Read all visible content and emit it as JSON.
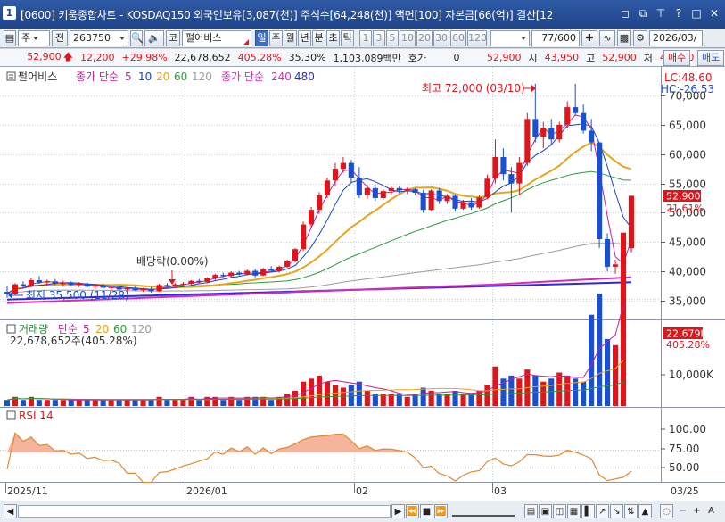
{
  "window": {
    "app_icon": "1",
    "title": "[0600] 키움종합차트 - KOSDAQ150 외국인보유[3,087(천)] 주식수[64,248(천)] 액면[100] 자본금[66(억)] 결산[12",
    "controls": [
      "minimize-icon",
      "restore-icon",
      "pin-icon",
      "help-icon",
      "maximize-icon",
      "close-icon"
    ]
  },
  "toolbar": {
    "period_type": "주",
    "market_btn": "전",
    "stock_code": "263750",
    "sound_icon": "speaker-icon",
    "market_tag": "코",
    "stock_name": "펄어비스",
    "periods": [
      "일",
      "주",
      "월",
      "년",
      "분",
      "초",
      "틱"
    ],
    "selected_period": "일",
    "intervals": [
      "1",
      "3",
      "5",
      "10",
      "20",
      "30",
      "60",
      "120"
    ],
    "page_counter": "77/600",
    "date": "2026/03/"
  },
  "pricebar": {
    "price": "52,900",
    "change": "12,200",
    "change_pct": "+29.98%",
    "volume": "22,678,652",
    "vol_ratio": "405.28%",
    "turnover": "35.30%",
    "amount": "1,103,089백만",
    "hoga_label": "호가",
    "hoga_value": "0",
    "ask_price": "52,900",
    "open_label": "시",
    "open": "43,950",
    "high_label": "고",
    "high": "52,900",
    "low_label": "저",
    "low": "43,250",
    "buy_btn": "매수",
    "sell_btn": "매도"
  },
  "legend": {
    "stock_tag": "펄어비스",
    "ma_label": "종가 단순",
    "ma_periods": [
      "5",
      "10",
      "20",
      "60",
      "120"
    ],
    "ma2_label": "종가 단순",
    "ma2_periods": [
      "240",
      "480"
    ]
  },
  "annotations": {
    "high_note": "최고 72,000 (03/10)",
    "low_note": "최저 35,500 (11/28)",
    "dividend_note": "배당락(0.00%)"
  },
  "price_axis": {
    "ticks": [
      "70,000",
      "65,000",
      "60,000",
      "55,000",
      "50,000",
      "45,000",
      "40,000",
      "35,000"
    ],
    "lc": "LC:48.60",
    "hc": "HC:-26.53",
    "current_price_tag": "52,900",
    "current_change_tag": "21.61%"
  },
  "volume_panel": {
    "title": "거래량",
    "ma_label": "단순",
    "ma_periods": [
      "5",
      "20",
      "60",
      "120"
    ],
    "value_text": "22,678,652주(405.28%)",
    "axis_tick": "10,000K",
    "current_tag": "22,679K",
    "current_pct": "405.28%"
  },
  "rsi_panel": {
    "title": "RSI 14",
    "ticks": [
      "100.00",
      "75.00",
      "50.00"
    ]
  },
  "date_axis": [
    "2025/11",
    "2026/01",
    "02",
    "03",
    "03/25"
  ],
  "colors": {
    "up": "#e1141a",
    "down": "#1b4fd1",
    "ma5": "#c21f9b",
    "ma10": "#1546c8",
    "ma20": "#e7a51a",
    "ma60": "#2d9a3b",
    "ma120": "#9c9c9c",
    "ma240": "#d62bb8",
    "ma480": "#2a2ad6"
  },
  "chart_data": {
    "type": "candlestick",
    "date_labels": [
      "2025/11",
      "2026/01",
      "02",
      "03"
    ],
    "candles": [
      {
        "o": 36500,
        "h": 37500,
        "l": 35500,
        "c": 36200
      },
      {
        "o": 36200,
        "h": 38000,
        "l": 36000,
        "c": 37800
      },
      {
        "o": 37800,
        "h": 38300,
        "l": 37200,
        "c": 37500
      },
      {
        "o": 37500,
        "h": 38800,
        "l": 37300,
        "c": 38500
      },
      {
        "o": 38500,
        "h": 39200,
        "l": 37900,
        "c": 38100
      },
      {
        "o": 38100,
        "h": 38600,
        "l": 37600,
        "c": 38300
      },
      {
        "o": 38300,
        "h": 38700,
        "l": 37700,
        "c": 37900
      },
      {
        "o": 37900,
        "h": 38400,
        "l": 37400,
        "c": 38000
      },
      {
        "o": 38000,
        "h": 38300,
        "l": 37500,
        "c": 37700
      },
      {
        "o": 37700,
        "h": 38200,
        "l": 37300,
        "c": 37900
      },
      {
        "o": 37900,
        "h": 38100,
        "l": 37200,
        "c": 37400
      },
      {
        "o": 37400,
        "h": 37900,
        "l": 37000,
        "c": 37600
      },
      {
        "o": 37600,
        "h": 37900,
        "l": 37000,
        "c": 37200
      },
      {
        "o": 37200,
        "h": 37600,
        "l": 36800,
        "c": 37300
      },
      {
        "o": 37300,
        "h": 37500,
        "l": 36700,
        "c": 36900
      },
      {
        "o": 36900,
        "h": 37300,
        "l": 36600,
        "c": 37100
      },
      {
        "o": 37100,
        "h": 37400,
        "l": 36700,
        "c": 36800
      },
      {
        "o": 36800,
        "h": 37200,
        "l": 36500,
        "c": 37000
      },
      {
        "o": 37000,
        "h": 37300,
        "l": 36400,
        "c": 36600
      },
      {
        "o": 36600,
        "h": 37900,
        "l": 36500,
        "c": 37700
      },
      {
        "o": 37700,
        "h": 38000,
        "l": 37200,
        "c": 37400
      },
      {
        "o": 37400,
        "h": 38000,
        "l": 37200,
        "c": 37800
      },
      {
        "o": 37800,
        "h": 38200,
        "l": 37500,
        "c": 37900
      },
      {
        "o": 37900,
        "h": 38500,
        "l": 37600,
        "c": 38400
      },
      {
        "o": 38400,
        "h": 38700,
        "l": 38000,
        "c": 38200
      },
      {
        "o": 38200,
        "h": 39000,
        "l": 38000,
        "c": 38800
      },
      {
        "o": 38800,
        "h": 39600,
        "l": 38500,
        "c": 39400
      },
      {
        "o": 39400,
        "h": 39800,
        "l": 39000,
        "c": 39200
      },
      {
        "o": 39200,
        "h": 40000,
        "l": 39000,
        "c": 39800
      },
      {
        "o": 39800,
        "h": 40100,
        "l": 39300,
        "c": 39500
      },
      {
        "o": 39500,
        "h": 40300,
        "l": 39300,
        "c": 40100
      },
      {
        "o": 40100,
        "h": 40400,
        "l": 39000,
        "c": 39300
      },
      {
        "o": 39300,
        "h": 40600,
        "l": 39200,
        "c": 40400
      },
      {
        "o": 40400,
        "h": 40900,
        "l": 39800,
        "c": 40100
      },
      {
        "o": 40100,
        "h": 41000,
        "l": 39800,
        "c": 40800
      },
      {
        "o": 40800,
        "h": 42000,
        "l": 40600,
        "c": 41800
      },
      {
        "o": 41800,
        "h": 44000,
        "l": 41500,
        "c": 43800
      },
      {
        "o": 43800,
        "h": 48500,
        "l": 43500,
        "c": 48000
      },
      {
        "o": 48000,
        "h": 51000,
        "l": 47500,
        "c": 50500
      },
      {
        "o": 50500,
        "h": 53500,
        "l": 49800,
        "c": 53000
      },
      {
        "o": 53000,
        "h": 56000,
        "l": 52500,
        "c": 55500
      },
      {
        "o": 55500,
        "h": 58500,
        "l": 54500,
        "c": 57500
      },
      {
        "o": 57500,
        "h": 59500,
        "l": 56800,
        "c": 58500
      },
      {
        "o": 58500,
        "h": 59000,
        "l": 55000,
        "c": 56000
      },
      {
        "o": 56000,
        "h": 57800,
        "l": 52500,
        "c": 53000
      },
      {
        "o": 53000,
        "h": 54800,
        "l": 52300,
        "c": 54200
      },
      {
        "o": 54200,
        "h": 54800,
        "l": 52000,
        "c": 52500
      },
      {
        "o": 52500,
        "h": 54000,
        "l": 52200,
        "c": 53700
      },
      {
        "o": 53700,
        "h": 54500,
        "l": 53000,
        "c": 54200
      },
      {
        "o": 54200,
        "h": 54600,
        "l": 53300,
        "c": 53800
      },
      {
        "o": 53800,
        "h": 54300,
        "l": 53200,
        "c": 54000
      },
      {
        "o": 54000,
        "h": 54200,
        "l": 53000,
        "c": 53400
      },
      {
        "o": 53400,
        "h": 53900,
        "l": 50000,
        "c": 50500
      },
      {
        "o": 50500,
        "h": 54000,
        "l": 50300,
        "c": 53800
      },
      {
        "o": 53800,
        "h": 54200,
        "l": 51500,
        "c": 52000
      },
      {
        "o": 52000,
        "h": 53200,
        "l": 51500,
        "c": 52900
      },
      {
        "o": 52900,
        "h": 53100,
        "l": 50200,
        "c": 50700
      },
      {
        "o": 50700,
        "h": 52200,
        "l": 50500,
        "c": 51800
      },
      {
        "o": 51800,
        "h": 52500,
        "l": 50500,
        "c": 50900
      },
      {
        "o": 50900,
        "h": 53000,
        "l": 50700,
        "c": 52600
      },
      {
        "o": 52600,
        "h": 56500,
        "l": 52300,
        "c": 55800
      },
      {
        "o": 55800,
        "h": 62500,
        "l": 55000,
        "c": 59500
      },
      {
        "o": 59500,
        "h": 61000,
        "l": 55500,
        "c": 56600
      },
      {
        "o": 56600,
        "h": 57800,
        "l": 50000,
        "c": 55000
      },
      {
        "o": 55000,
        "h": 59500,
        "l": 53000,
        "c": 58500
      },
      {
        "o": 58500,
        "h": 67000,
        "l": 58000,
        "c": 66000
      },
      {
        "o": 66000,
        "h": 72000,
        "l": 62000,
        "c": 63000
      },
      {
        "o": 63000,
        "h": 65500,
        "l": 61000,
        "c": 64500
      },
      {
        "o": 64500,
        "h": 66000,
        "l": 61500,
        "c": 62500
      },
      {
        "o": 62500,
        "h": 65500,
        "l": 62000,
        "c": 65000
      },
      {
        "o": 65000,
        "h": 69000,
        "l": 64500,
        "c": 68000
      },
      {
        "o": 68000,
        "h": 72000,
        "l": 66500,
        "c": 67000
      },
      {
        "o": 67000,
        "h": 68500,
        "l": 63500,
        "c": 64000
      },
      {
        "o": 64000,
        "h": 66000,
        "l": 60500,
        "c": 62000
      },
      {
        "o": 62000,
        "h": 57500,
        "l": 44000,
        "c": 45500
      },
      {
        "o": 45500,
        "h": 46500,
        "l": 40000,
        "c": 40800
      },
      {
        "o": 40800,
        "h": 42000,
        "l": 39600,
        "c": 41200
      },
      {
        "o": 41200,
        "h": 42200,
        "l": 40700,
        "c": 42000
      },
      {
        "o": 43950,
        "h": 52900,
        "l": 43250,
        "c": 52900
      }
    ],
    "volume": [
      2,
      3,
      2,
      3,
      2,
      2,
      2,
      2,
      2,
      2,
      2,
      2,
      2,
      2,
      2,
      2,
      2,
      2,
      2,
      3,
      2,
      2,
      2,
      3,
      2,
      3,
      3,
      2,
      3,
      2,
      3,
      3,
      3,
      2,
      3,
      4,
      5,
      8,
      9,
      10,
      8,
      7,
      6,
      7,
      8,
      5,
      4,
      4,
      4,
      4,
      3,
      4,
      6,
      5,
      4,
      4,
      5,
      4,
      4,
      5,
      7,
      13,
      9,
      10,
      9,
      12,
      10,
      8,
      9,
      11,
      10,
      9,
      8,
      30,
      37,
      22,
      20,
      57
    ],
    "volume_unit": "K",
    "ylim": [
      33000,
      73000
    ]
  }
}
